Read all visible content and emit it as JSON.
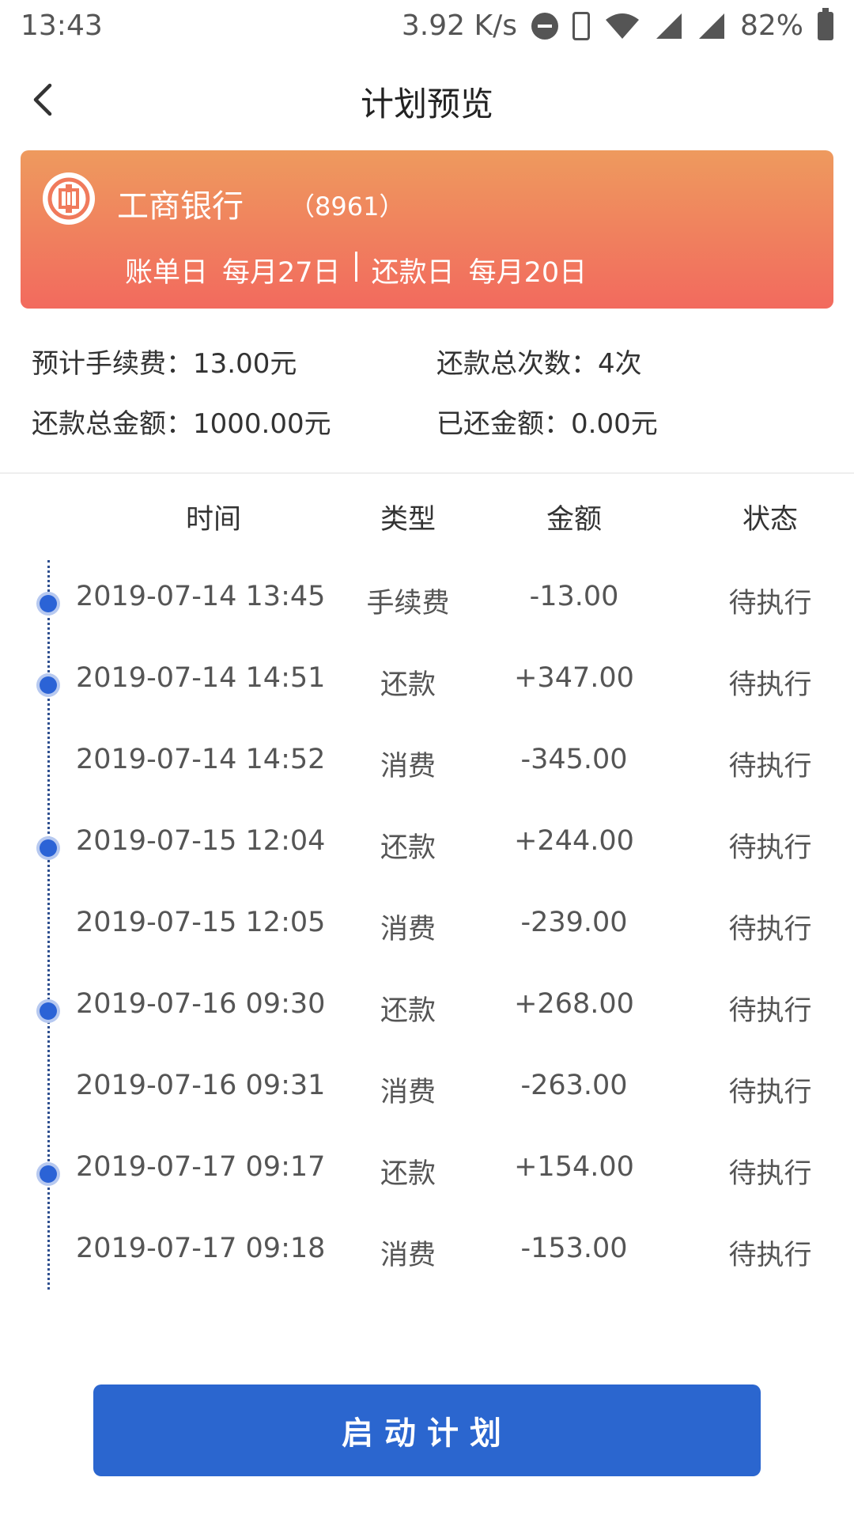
{
  "status_bar": {
    "time": "13:43",
    "net_speed": "3.92 K/s",
    "battery": "82%"
  },
  "header": {
    "title": "计划预览"
  },
  "bank_card": {
    "bank_name": "工商银行",
    "card_suffix": "（8961）",
    "bill_day_label": "账单日",
    "bill_day_value": "每月27日",
    "repay_day_label": "还款日",
    "repay_day_value": "每月20日",
    "gradient_top": "#ee9a5e",
    "gradient_bottom": "#f26a5e"
  },
  "summary": {
    "fee": "预计手续费：13.00元",
    "repay_count": "还款总次数：4次",
    "repay_total": "还款总金额：1000.00元",
    "repaid_amount": "已还金额：0.00元"
  },
  "table": {
    "headers": [
      "时间",
      "类型",
      "金额",
      "状态"
    ],
    "rows": [
      {
        "time": "2019-07-14 13:45",
        "type": "手续费",
        "amount": "-13.00",
        "status": "待执行",
        "marker": true
      },
      {
        "time": "2019-07-14 14:51",
        "type": "还款",
        "amount": "+347.00",
        "status": "待执行",
        "marker": true
      },
      {
        "time": "2019-07-14 14:52",
        "type": "消费",
        "amount": "-345.00",
        "status": "待执行",
        "marker": false
      },
      {
        "time": "2019-07-15 12:04",
        "type": "还款",
        "amount": "+244.00",
        "status": "待执行",
        "marker": true
      },
      {
        "time": "2019-07-15 12:05",
        "type": "消费",
        "amount": "-239.00",
        "status": "待执行",
        "marker": false
      },
      {
        "time": "2019-07-16 09:30",
        "type": "还款",
        "amount": "+268.00",
        "status": "待执行",
        "marker": true
      },
      {
        "time": "2019-07-16 09:31",
        "type": "消费",
        "amount": "-263.00",
        "status": "待执行",
        "marker": false
      },
      {
        "time": "2019-07-17 09:17",
        "type": "还款",
        "amount": "+154.00",
        "status": "待执行",
        "marker": true
      },
      {
        "time": "2019-07-17 09:18",
        "type": "消费",
        "amount": "-153.00",
        "status": "待执行",
        "marker": false
      }
    ]
  },
  "action": {
    "start_label": "启动计划",
    "color": "#2b66cf"
  }
}
